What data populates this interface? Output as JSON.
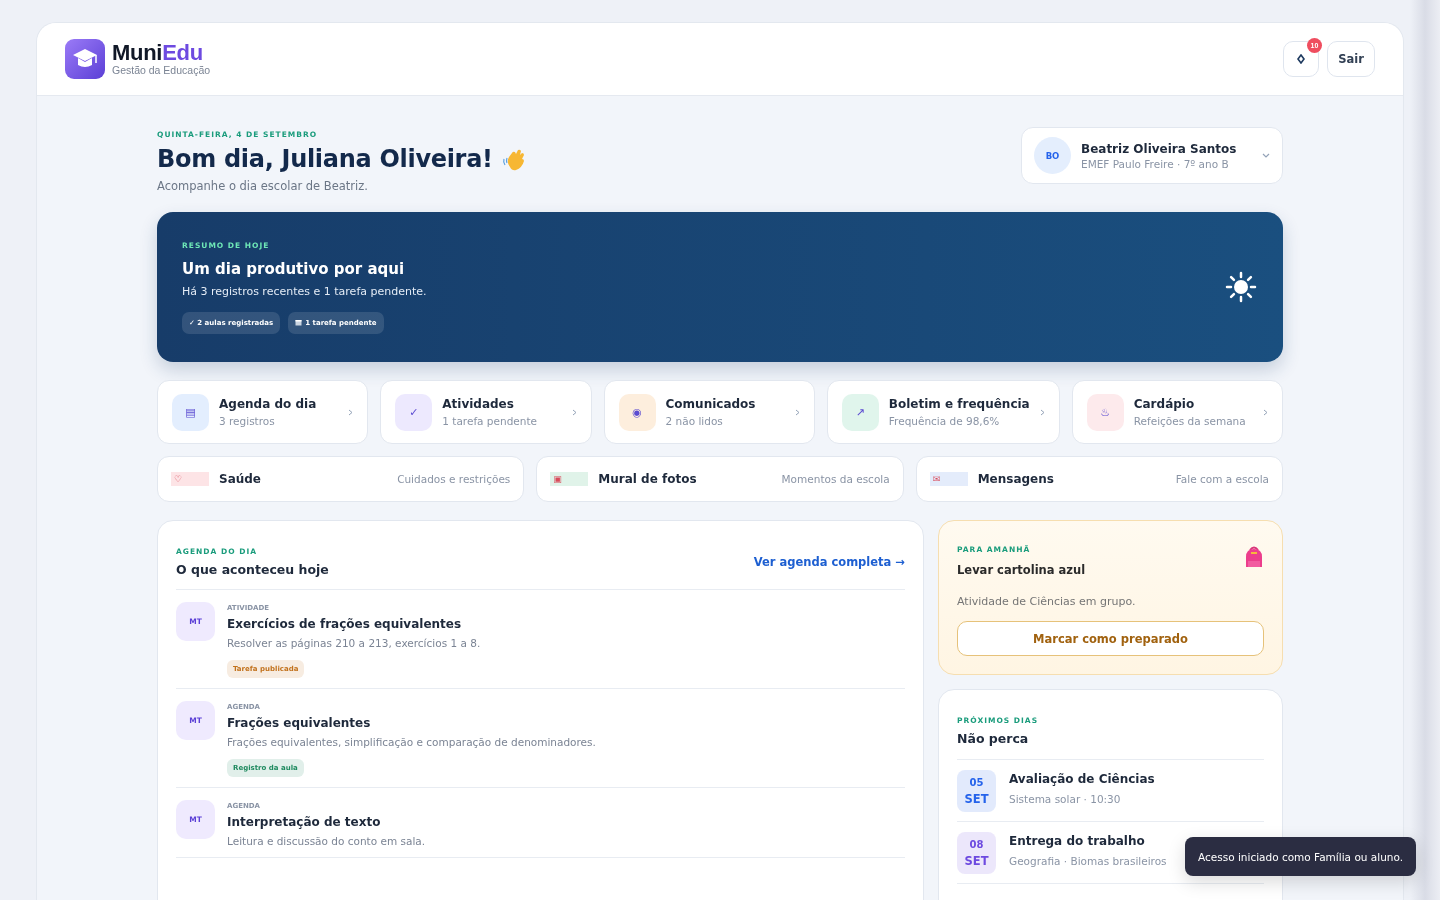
{
  "brand": {
    "name": "Muni",
    "name_accent": "Edu",
    "tagline": "Gestão da Educação"
  },
  "header": {
    "notification_count": "10",
    "logout": "Sair"
  },
  "greeting": {
    "date": "QUINTA-FEIRA, 4 DE SETEMBRO",
    "title": "Bom dia, Juliana Oliveira!",
    "subtitle": "Acompanhe o dia escolar de Beatriz."
  },
  "student": {
    "initials": "BO",
    "name": "Beatriz Oliveira Santos",
    "detail": "EMEF Paulo Freire · 7º ano B"
  },
  "summary": {
    "eyebrow": "RESUMO DE HOJE",
    "title": "Um dia produtivo por aqui",
    "text": "Há 3 registros recentes e 1 tarefa pendente.",
    "pills": [
      {
        "kind": "check",
        "label": "✓ 2 aulas registradas"
      },
      {
        "kind": "calendar",
        "label": "1 tarefa pendente"
      }
    ]
  },
  "shortcuts": [
    {
      "icon": "▤",
      "title": "Agenda do dia",
      "subtitle": "3 registros",
      "color": "#e3eefe"
    },
    {
      "icon": "✓",
      "title": "Atividades",
      "subtitle": "1 tarefa pendente",
      "color": "#ede9fe"
    },
    {
      "icon": "◉",
      "title": "Comunicados",
      "subtitle": "2 não lidos",
      "color": "#fdeedd"
    },
    {
      "icon": "↗",
      "title": "Boletim e frequência",
      "subtitle": "Frequência de 98,6%",
      "color": "#e0f5ec"
    },
    {
      "icon": "♨",
      "title": "Cardápio",
      "subtitle": "Refeições da semana",
      "color": "#fdeaec"
    }
  ],
  "links": [
    {
      "icon": "♡",
      "title": "Saúde",
      "subtitle": "Cuidados e restrições",
      "color": "#fde4e6"
    },
    {
      "icon": "▣",
      "title": "Mural de fotos",
      "subtitle": "Momentos da escola",
      "color": "#e0f3e9"
    },
    {
      "icon": "✉",
      "title": "Mensagens",
      "subtitle": "Fale com a escola",
      "color": "#e4ecfb"
    }
  ],
  "agenda": {
    "eyebrow": "AGENDA DO DIA",
    "title": "O que aconteceu hoje",
    "link": "Ver agenda completa →",
    "items": [
      {
        "subject": "MT",
        "type": "ATIVIDADE",
        "title": "Exercícios de frações equivalentes",
        "text": "Resolver as páginas 210 a 213, exercícios 1 a 8.",
        "tag": "Tarefa publicada",
        "color": "#c2721d"
      },
      {
        "subject": "MT",
        "type": "AGENDA",
        "title": "Frações equivalentes",
        "text": "Frações equivalentes, simplificação e comparação de denominadores.",
        "tag": "Registro da aula",
        "color": "#1f8a5f"
      },
      {
        "subject": "MT",
        "type": "AGENDA",
        "title": "Interpretação de texto",
        "text": "Leitura e discussão do conto em sala."
      }
    ]
  },
  "tomorrow": {
    "eyebrow": "PARA AMANHÃ",
    "title": "Levar cartolina azul",
    "text": "Atividade de Ciências em grupo.",
    "button": "Marcar como preparado"
  },
  "upcoming": {
    "eyebrow": "PRÓXIMOS DIAS",
    "title": "Não perca",
    "items": [
      {
        "day": "05",
        "month": "SET",
        "title": "Avaliação de Ciências",
        "detail": "Sistema solar · 10:30",
        "color": "#2563eb"
      },
      {
        "day": "08",
        "month": "SET",
        "title": "Entrega do trabalho",
        "detail": "Geografia · Biomas brasileiros",
        "color": "#6d4ae0"
      }
    ]
  },
  "toast": "Acesso iniciado como Família ou aluno."
}
